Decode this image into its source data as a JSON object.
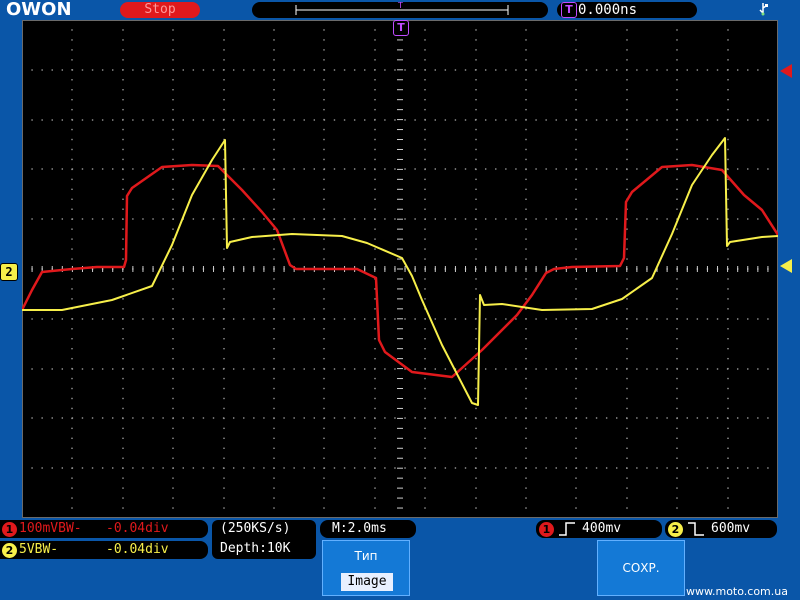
{
  "header": {
    "logo": "OWON",
    "run_state": "Stop",
    "trigger_position": "0.000ns",
    "trigger_icon": "T"
  },
  "screen": {
    "trigger_time_marker": "T",
    "ch2_ground_marker": "2"
  },
  "channels": {
    "ch1": {
      "badge": "1",
      "setting": "100mVBW-",
      "offset": "-0.04div",
      "color": "#e0191c"
    },
    "ch2": {
      "badge": "2",
      "setting": "5VBW-",
      "offset": "-0.04div",
      "color": "#f7ef4a"
    }
  },
  "acquisition": {
    "sample_rate": "(250KS/s)",
    "depth": "Depth:10K",
    "timebase": "M:2.0ms"
  },
  "trigger": {
    "ch1_badge": "1",
    "ch1_level": "400mv",
    "ch1_edge": "rising",
    "ch2_badge": "2",
    "ch2_level": "600mv",
    "ch2_edge": "falling"
  },
  "softkeys": {
    "type_title": "Тип",
    "type_value": "Image",
    "save_title": "СОХР."
  },
  "watermark": "www.moto.com.ua",
  "colors": {
    "background": "#0a56a8",
    "screen": "#000000",
    "ch1": "#e0191c",
    "ch2": "#f7ef4a",
    "trigger_marker": "#c04cff"
  },
  "icons": {
    "usb": "usb-icon",
    "trigger_position": "trigger-position-icon"
  }
}
